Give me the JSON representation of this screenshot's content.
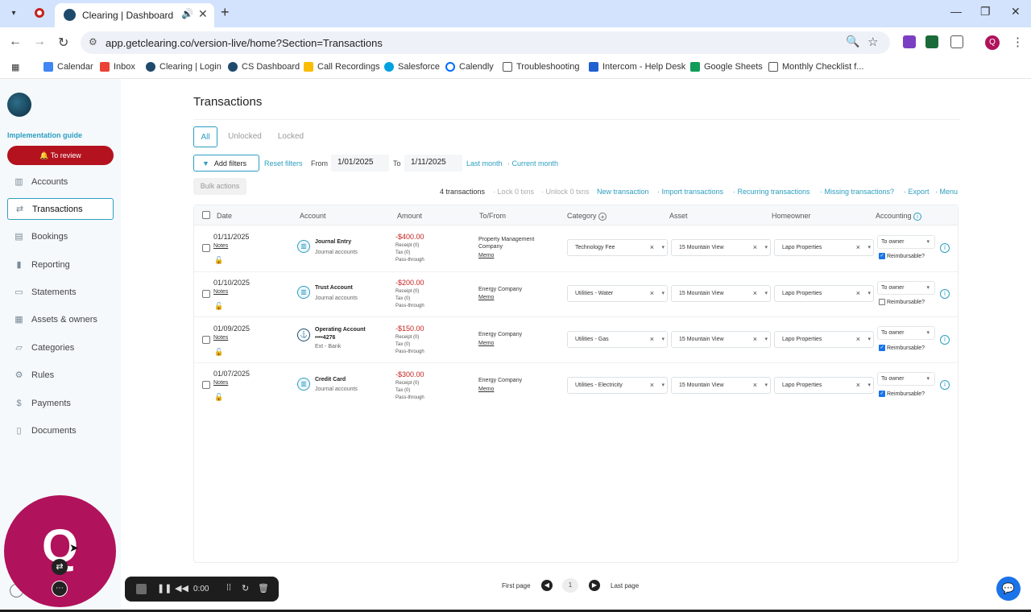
{
  "browser": {
    "tab_title": "Clearing | Dashboard",
    "url": "app.getclearing.co/version-live/home?Section=Transactions",
    "profile_initial": "Q",
    "bookmarks": [
      "Calendar",
      "Inbox",
      "Clearing | Login",
      "CS Dashboard",
      "Call Recordings",
      "Salesforce",
      "Calendly",
      "Troubleshooting",
      "Intercom - Help Desk",
      "Google Sheets",
      "Monthly Checklist f..."
    ]
  },
  "sidebar": {
    "implementation_guide": "Implementation guide",
    "review_button": "To review",
    "items": [
      {
        "label": "Accounts",
        "icon": "bank-icon"
      },
      {
        "label": "Transactions",
        "icon": "transfer-icon"
      },
      {
        "label": "Bookings",
        "icon": "calendar-icon"
      },
      {
        "label": "Reporting",
        "icon": "bar-chart-icon"
      },
      {
        "label": "Statements",
        "icon": "document-icon"
      },
      {
        "label": "Assets & owners",
        "icon": "building-icon"
      },
      {
        "label": "Categories",
        "icon": "folder-icon"
      },
      {
        "label": "Rules",
        "icon": "gear-icon"
      },
      {
        "label": "Payments",
        "icon": "dollar-icon"
      },
      {
        "label": "Documents",
        "icon": "file-icon"
      }
    ]
  },
  "main": {
    "title": "Transactions",
    "segments": [
      "All",
      "Unlocked",
      "Locked"
    ],
    "filters": {
      "add_filters": "Add filters",
      "reset_filters": "Reset filters",
      "from_label": "From",
      "from_value": "1/01/2025",
      "to_label": "To",
      "to_value": "1/11/2025",
      "last_month": "Last month",
      "current_month": "Current month"
    },
    "bulk_actions": "Bulk actions",
    "actions_bar": {
      "count": "4 transactions",
      "lock": "Lock 0 txns",
      "unlock": "Unlock 0 txns",
      "new": "New transaction",
      "import": "Import transactions",
      "recurring": "Recurring transactions",
      "missing": "Missing transactions?",
      "export": "Export",
      "menu": "Menu"
    },
    "columns": [
      "Date",
      "Account",
      "Amount",
      "To/From",
      "Category",
      "Asset",
      "Homeowner",
      "Accounting"
    ],
    "rows": [
      {
        "date": "01/11/2025",
        "notes": "Notes",
        "account": "Journal Entry",
        "account_sub": "Journal accounts",
        "account_sub2": "",
        "amount": "-$400.00",
        "to_from": "Property Management Company",
        "memo": "Memo",
        "category": "Technology Fee",
        "asset": "15 Mountain View",
        "homeowner": "Lapo Properties",
        "accounting": "To owner",
        "reimbursable": true
      },
      {
        "date": "01/10/2025",
        "notes": "Notes",
        "account": "Trust Account",
        "account_sub": "Journal accounts",
        "account_sub2": "",
        "amount": "-$200.00",
        "to_from": "Energy Company",
        "memo": "Memo",
        "category": "Utilities - Water",
        "asset": "15 Mountain View",
        "homeowner": "Lapo Properties",
        "accounting": "To owner",
        "reimbursable": false
      },
      {
        "date": "01/09/2025",
        "notes": "Notes",
        "account": "Operating Account",
        "account_sub": "••••4276",
        "account_sub2": "Ext - Bank",
        "amount": "-$150.00",
        "to_from": "Energy Company",
        "memo": "Memo",
        "category": "Utilities - Gas",
        "asset": "15 Mountain View",
        "homeowner": "Lapo Properties",
        "accounting": "To owner",
        "reimbursable": true
      },
      {
        "date": "01/07/2025",
        "notes": "Notes",
        "account": "Credit Card",
        "account_sub": "Journal accounts",
        "account_sub2": "",
        "amount": "-$300.00",
        "to_from": "Energy Company",
        "memo": "Memo",
        "category": "Utilities - Electricity",
        "asset": "15 Mountain View",
        "homeowner": "Lapo Properties",
        "accounting": "To owner",
        "reimbursable": true
      }
    ],
    "amount_breakdown": {
      "receipt": "Receipt (0)",
      "tax": "Tax (0)",
      "pass": "Pass-through"
    },
    "reimbursable_label": "Reimbursable?",
    "pagination": {
      "first": "First page",
      "current": "1",
      "last": "Last page"
    }
  },
  "recorder": {
    "time": "0:00",
    "camera_initial": "Q"
  },
  "colors": {
    "accent": "#2d9ec0",
    "danger": "#c5221f",
    "review": "#b3121e",
    "camera": "#b0125b"
  }
}
